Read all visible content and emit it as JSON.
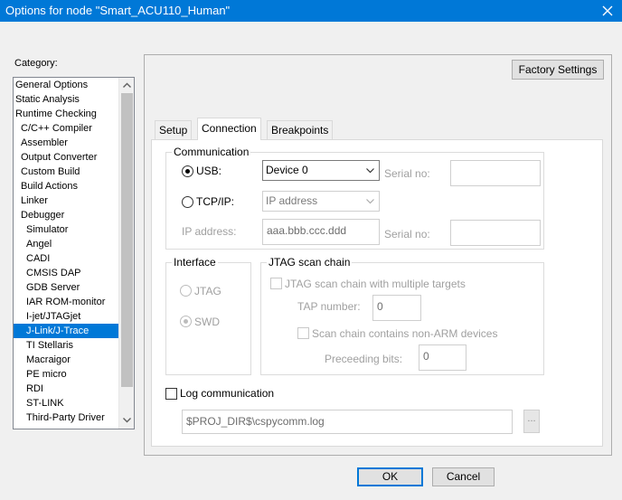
{
  "window": {
    "title": "Options for node \"Smart_ACU110_Human\"",
    "close_icon": "close-icon"
  },
  "category": {
    "label": "Category:",
    "items": [
      {
        "label": "General Options",
        "level": 0
      },
      {
        "label": "Static Analysis",
        "level": 0
      },
      {
        "label": "Runtime Checking",
        "level": 0
      },
      {
        "label": "C/C++ Compiler",
        "level": 1
      },
      {
        "label": "Assembler",
        "level": 1
      },
      {
        "label": "Output Converter",
        "level": 1
      },
      {
        "label": "Custom Build",
        "level": 1
      },
      {
        "label": "Build Actions",
        "level": 1
      },
      {
        "label": "Linker",
        "level": 1
      },
      {
        "label": "Debugger",
        "level": 1
      },
      {
        "label": "Simulator",
        "level": 2
      },
      {
        "label": "Angel",
        "level": 2
      },
      {
        "label": "CADI",
        "level": 2
      },
      {
        "label": "CMSIS DAP",
        "level": 2
      },
      {
        "label": "GDB Server",
        "level": 2
      },
      {
        "label": "IAR ROM-monitor",
        "level": 2
      },
      {
        "label": "I-jet/JTAGjet",
        "level": 2
      },
      {
        "label": "J-Link/J-Trace",
        "level": 2
      },
      {
        "label": "TI Stellaris",
        "level": 2
      },
      {
        "label": "Macraigor",
        "level": 2
      },
      {
        "label": "PE micro",
        "level": 2
      },
      {
        "label": "RDI",
        "level": 2
      },
      {
        "label": "ST-LINK",
        "level": 2
      },
      {
        "label": "Third-Party Driver",
        "level": 2
      }
    ],
    "selected": "J-Link/J-Trace"
  },
  "factory_settings": "Factory Settings",
  "tabs": [
    {
      "label": "Setup"
    },
    {
      "label": "Connection"
    },
    {
      "label": "Breakpoints"
    }
  ],
  "active_tab": "Connection",
  "communication": {
    "label": "Communication",
    "usb_label": "USB:",
    "usb_selected": true,
    "usb_device": "Device 0",
    "serial_no_label": "Serial no:",
    "serial_no_value": "",
    "tcpip_label": "TCP/IP:",
    "tcpip_selected": false,
    "tcpip_mode": "IP address",
    "ip_address_label": "IP address:",
    "ip_address_value": "aaa.bbb.ccc.ddd",
    "serial_no2_label": "Serial no:",
    "serial_no2_value": ""
  },
  "interface": {
    "label": "Interface",
    "jtag_label": "JTAG",
    "swd_label": "SWD",
    "selected": "SWD"
  },
  "jtag_scan": {
    "label": "JTAG scan chain",
    "multi_targets_label": "JTAG scan chain with multiple targets",
    "tap_number_label": "TAP number:",
    "tap_number_value": "0",
    "non_arm_label": "Scan chain contains non-ARM devices",
    "preceding_bits_label": "Preceeding bits:",
    "preceding_bits_value": "0"
  },
  "log": {
    "label": "Log communication",
    "checked": false,
    "path": "$PROJ_DIR$\\cspycomm.log",
    "browse_label": "..."
  },
  "buttons": {
    "ok": "OK",
    "cancel": "Cancel"
  }
}
